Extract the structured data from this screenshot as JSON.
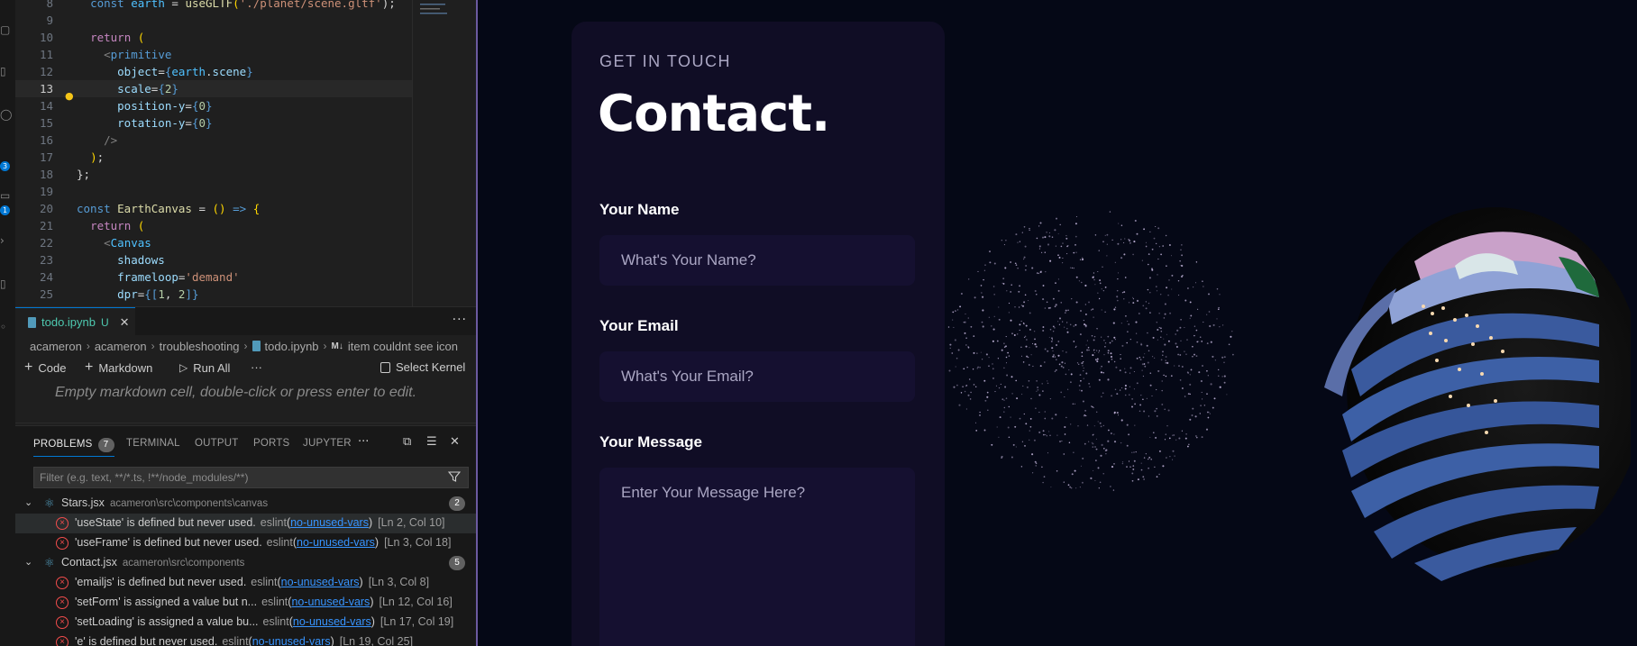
{
  "editor": {
    "lines": [
      {
        "num": "8",
        "tokens": [
          [
            "  ",
            "t-def"
          ],
          [
            "const ",
            "t-kw"
          ],
          [
            "earth",
            "t-const"
          ],
          [
            " = ",
            "t-def"
          ],
          [
            "useGLTF",
            "t-fn"
          ],
          [
            "(",
            "t-brace"
          ],
          [
            "'./planet/scene.gltf'",
            "t-str"
          ],
          [
            ");",
            "t-def"
          ]
        ]
      },
      {
        "num": "9",
        "tokens": []
      },
      {
        "num": "10",
        "tokens": [
          [
            "  ",
            "t-def"
          ],
          [
            "return ",
            "t-cl"
          ],
          [
            "(",
            "t-brace"
          ]
        ]
      },
      {
        "num": "11",
        "tokens": [
          [
            "    ",
            "t-def"
          ],
          [
            "<",
            "t-gray"
          ],
          [
            "primitive",
            "t-tag"
          ]
        ]
      },
      {
        "num": "12",
        "tokens": [
          [
            "      ",
            "t-def"
          ],
          [
            "object",
            "t-var"
          ],
          [
            "=",
            "t-def"
          ],
          [
            "{",
            "t-kw"
          ],
          [
            "earth",
            "t-const"
          ],
          [
            ".",
            "t-def"
          ],
          [
            "scene",
            "t-var"
          ],
          [
            "}",
            "t-kw"
          ]
        ]
      },
      {
        "num": "13",
        "tokens": [
          [
            "      ",
            "t-def"
          ],
          [
            "scale",
            "t-var"
          ],
          [
            "=",
            "t-def"
          ],
          [
            "{",
            "t-kw"
          ],
          [
            "2",
            "t-num"
          ],
          [
            "}",
            "t-kw"
          ]
        ]
      },
      {
        "num": "14",
        "tokens": [
          [
            "      ",
            "t-def"
          ],
          [
            "position-y",
            "t-var"
          ],
          [
            "=",
            "t-def"
          ],
          [
            "{",
            "t-kw"
          ],
          [
            "0",
            "t-num"
          ],
          [
            "}",
            "t-kw"
          ]
        ]
      },
      {
        "num": "15",
        "tokens": [
          [
            "      ",
            "t-def"
          ],
          [
            "rotation-y",
            "t-var"
          ],
          [
            "=",
            "t-def"
          ],
          [
            "{",
            "t-kw"
          ],
          [
            "0",
            "t-num"
          ],
          [
            "}",
            "t-kw"
          ]
        ]
      },
      {
        "num": "16",
        "tokens": [
          [
            "    ",
            "t-def"
          ],
          [
            "/>",
            "t-gray"
          ]
        ]
      },
      {
        "num": "17",
        "tokens": [
          [
            "  ",
            "t-def"
          ],
          [
            ")",
            "t-brace"
          ],
          [
            ";",
            "t-def"
          ]
        ]
      },
      {
        "num": "18",
        "tokens": [
          [
            "};",
            "t-def"
          ]
        ]
      },
      {
        "num": "19",
        "tokens": []
      },
      {
        "num": "20",
        "tokens": [
          [
            "const ",
            "t-kw"
          ],
          [
            "EarthCanvas",
            "t-fn"
          ],
          [
            " = ",
            "t-def"
          ],
          [
            "()",
            "t-brace"
          ],
          [
            " => ",
            "t-kw"
          ],
          [
            "{",
            "t-brace"
          ]
        ]
      },
      {
        "num": "21",
        "tokens": [
          [
            "  ",
            "t-def"
          ],
          [
            "return ",
            "t-cl"
          ],
          [
            "(",
            "t-brace"
          ]
        ]
      },
      {
        "num": "22",
        "tokens": [
          [
            "    ",
            "t-def"
          ],
          [
            "<",
            "t-gray"
          ],
          [
            "Canvas",
            "t-const"
          ]
        ]
      },
      {
        "num": "23",
        "tokens": [
          [
            "      ",
            "t-def"
          ],
          [
            "shadows",
            "t-var"
          ]
        ]
      },
      {
        "num": "24",
        "tokens": [
          [
            "      ",
            "t-def"
          ],
          [
            "frameloop",
            "t-var"
          ],
          [
            "=",
            "t-def"
          ],
          [
            "'demand'",
            "t-str"
          ]
        ]
      },
      {
        "num": "25",
        "tokens": [
          [
            "      ",
            "t-def"
          ],
          [
            "dpr",
            "t-var"
          ],
          [
            "=",
            "t-def"
          ],
          [
            "{[",
            "t-kw"
          ],
          [
            "1",
            "t-num"
          ],
          [
            ", ",
            "t-def"
          ],
          [
            "2",
            "t-num"
          ],
          [
            "]}",
            "t-kw"
          ]
        ]
      }
    ],
    "current_line": "13"
  },
  "notebook": {
    "tab_name": "todo.ipynb",
    "tab_status": "U",
    "breadcrumbs": [
      "acameron",
      "acameron",
      "troubleshooting",
      "todo.ipynb",
      "item couldnt see icon"
    ],
    "toolbar": {
      "code": "Code",
      "markdown": "Markdown",
      "run_all": "Run All",
      "select_kernel": "Select Kernel"
    },
    "md_cell_placeholder": "Empty markdown cell, double-click or press enter to edit."
  },
  "panel": {
    "tabs": {
      "problems": "PROBLEMS",
      "terminal": "TERMINAL",
      "output": "OUTPUT",
      "ports": "PORTS",
      "jupyter": "JUPYTER"
    },
    "problems_count": "7",
    "filter_placeholder": "Filter (e.g. text, **/*.ts, !**/node_modules/**)",
    "groups": [
      {
        "file": "Stars.jsx",
        "path": "acameron\\src\\components\\canvas",
        "count": "2",
        "items": [
          {
            "msg": "'useState' is defined but never used.",
            "source": "eslint",
            "code": "no-unused-vars",
            "pos": "[Ln 2, Col 10]"
          },
          {
            "msg": "'useFrame' is defined but never used.",
            "source": "eslint",
            "code": "no-unused-vars",
            "pos": "[Ln 3, Col 18]"
          }
        ]
      },
      {
        "file": "Contact.jsx",
        "path": "acameron\\src\\components",
        "count": "5",
        "items": [
          {
            "msg": "'emailjs' is defined but never used.",
            "source": "eslint",
            "code": "no-unused-vars",
            "pos": "[Ln 3, Col 8]"
          },
          {
            "msg": "'setForm' is assigned a value but n...",
            "source": "eslint",
            "code": "no-unused-vars",
            "pos": "[Ln 12, Col 16]"
          },
          {
            "msg": "'setLoading' is assigned a value bu...",
            "source": "eslint",
            "code": "no-unused-vars",
            "pos": "[Ln 17, Col 19]"
          },
          {
            "msg": "'e' is defined but never used.",
            "source": "eslint",
            "code": "no-unused-vars",
            "pos": "[Ln 19, Col 25]"
          }
        ]
      }
    ]
  },
  "contact": {
    "subtitle": "Get in touch",
    "heading": "Contact.",
    "name_label": "Your Name",
    "name_placeholder": "What's Your Name?",
    "email_label": "Your Email",
    "email_placeholder": "What's Your Email?",
    "message_label": "Your Message",
    "message_placeholder": "Enter Your Message Here?"
  },
  "activity_badges": [
    "3",
    "1"
  ],
  "colors": {
    "site_bg": "#050816",
    "card_bg": "#100d25",
    "input_bg": "#151030",
    "accent": "#0078d4",
    "error": "#f14c4c"
  }
}
